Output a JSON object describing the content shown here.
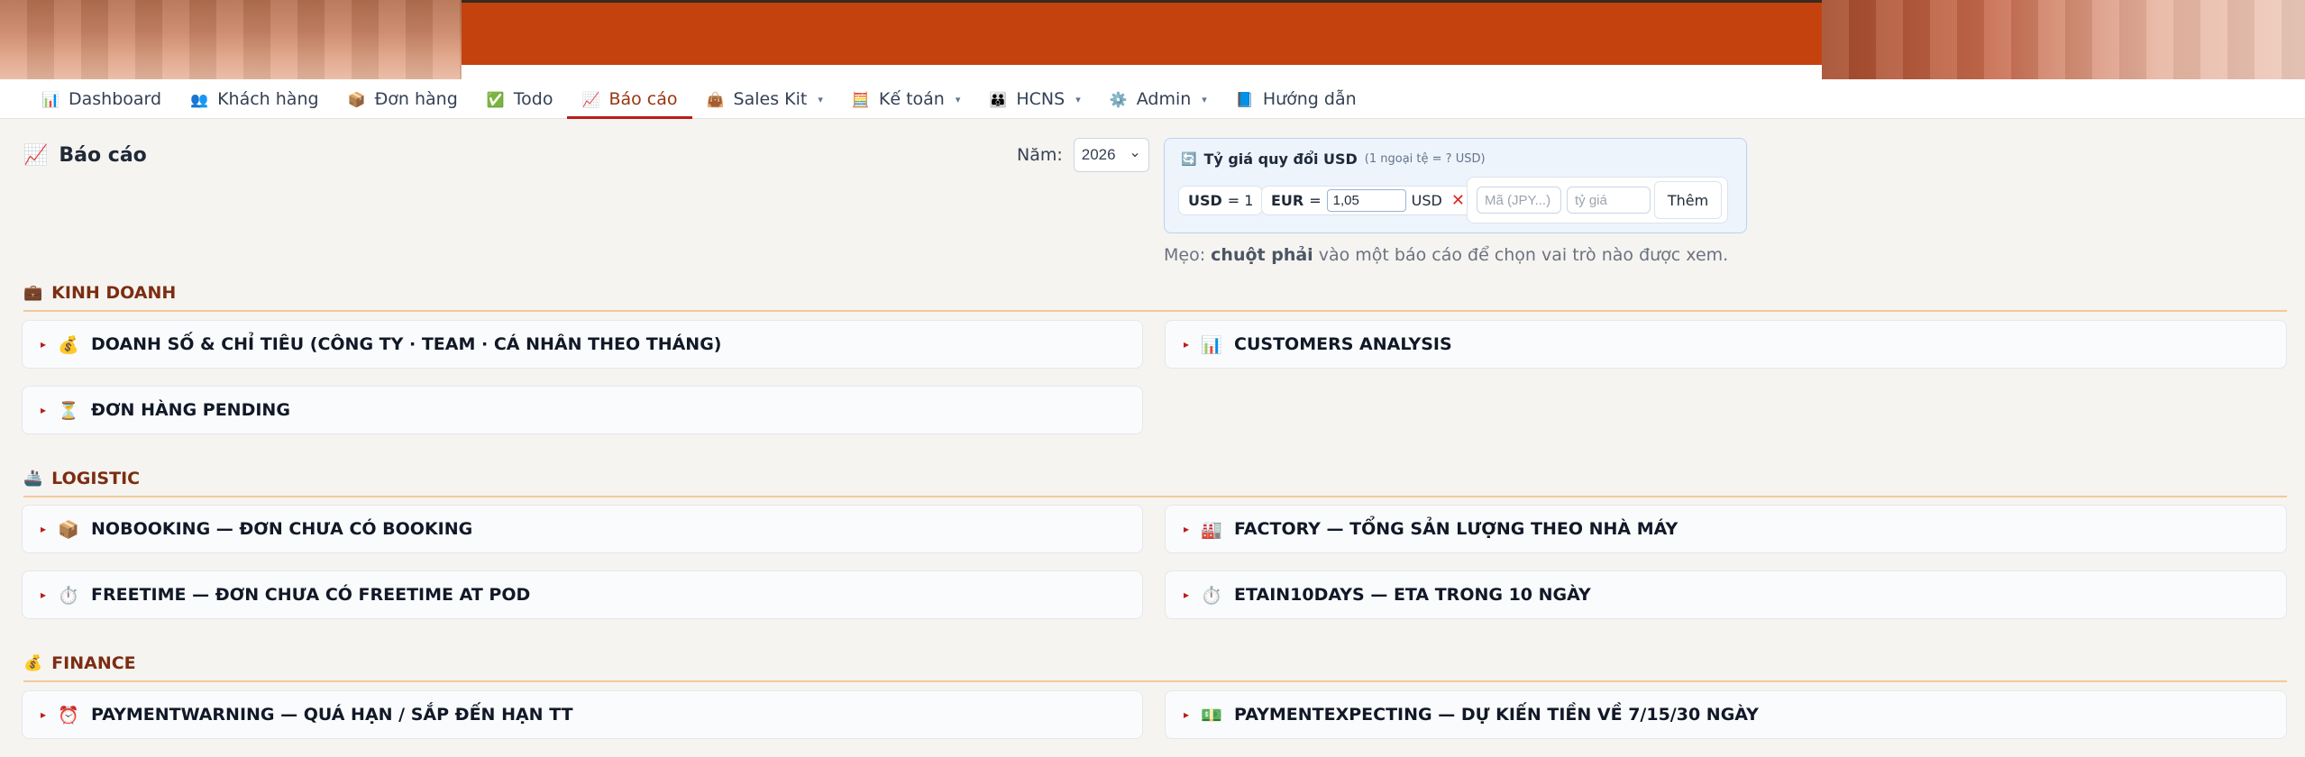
{
  "nav": {
    "items": [
      {
        "label": "Dashboard",
        "icon": "📊",
        "icon_name": "chart-bar-icon",
        "dropdown": false,
        "active": false
      },
      {
        "label": "Khách hàng",
        "icon": "👥",
        "icon_name": "users-icon",
        "dropdown": false,
        "active": false
      },
      {
        "label": "Đơn hàng",
        "icon": "📦",
        "icon_name": "package-icon",
        "dropdown": false,
        "active": false
      },
      {
        "label": "Todo",
        "icon": "✅",
        "icon_name": "checkbox-icon",
        "dropdown": false,
        "active": false
      },
      {
        "label": "Báo cáo",
        "icon": "📈",
        "icon_name": "chart-up-icon",
        "dropdown": false,
        "active": true
      },
      {
        "label": "Sales Kit",
        "icon": "👜",
        "icon_name": "bag-icon",
        "dropdown": true,
        "active": false
      },
      {
        "label": "Kế toán",
        "icon": "🧮",
        "icon_name": "abacus-icon",
        "dropdown": true,
        "active": false
      },
      {
        "label": "HCNS",
        "icon": "👪",
        "icon_name": "family-icon",
        "dropdown": true,
        "active": false
      },
      {
        "label": "Admin",
        "icon": "⚙️",
        "icon_name": "gear-icon",
        "dropdown": true,
        "active": false
      },
      {
        "label": "Hướng dẫn",
        "icon": "📘",
        "icon_name": "book-icon",
        "dropdown": false,
        "active": false
      }
    ]
  },
  "page": {
    "title": "Báo cáo",
    "title_icon": "📈",
    "year_label": "Năm:",
    "year_value": "2026"
  },
  "fx": {
    "title": "Tỷ giá quy đổi USD",
    "note": "(1 ngoại tệ = ? USD)",
    "title_icon": "🔄",
    "base_code": "USD",
    "base_eq": "= 1",
    "rate_code": "EUR",
    "rate_eq": "=",
    "rate_value": "1,05",
    "rate_unit": "USD",
    "remove_glyph": "✕",
    "code_placeholder": "Mã (JPY...)",
    "rate_placeholder": "tỷ giá",
    "add_label": "Thêm"
  },
  "tip": {
    "prefix": "Mẹo:",
    "bold": "chuột phải",
    "suffix": "vào một báo cáo để chọn vai trò nào được xem."
  },
  "sections": [
    {
      "title": "KINH DOANH",
      "icon": "💼",
      "reports": [
        {
          "label": "DOANH SỐ & CHỈ TIÊU (CÔNG TY · TEAM · CÁ NHÂN THEO THÁNG)",
          "icon": "💰"
        },
        {
          "label": "CUSTOMERS ANALYSIS",
          "icon": "📊"
        },
        {
          "label": "ĐƠN HÀNG PENDING",
          "icon": "⏳"
        }
      ]
    },
    {
      "title": "LOGISTIC",
      "icon": "🚢",
      "reports": [
        {
          "label": "NOBOOKING — ĐƠN CHƯA CÓ BOOKING",
          "icon": "📦"
        },
        {
          "label": "FACTORY — TỔNG SẢN LƯỢNG THEO NHÀ MÁY",
          "icon": "🏭"
        },
        {
          "label": "FREETIME — ĐƠN CHƯA CÓ FREETIME AT POD",
          "icon": "⏱️"
        },
        {
          "label": "ETAIN10DAYS — ETA TRONG 10 NGÀY",
          "icon": "⏱️"
        }
      ]
    },
    {
      "title": "FINANCE",
      "icon": "💰",
      "reports": [
        {
          "label": "PAYMENTWARNING — QUÁ HẠN / SẮP ĐẾN HẠN TT",
          "icon": "⏰"
        },
        {
          "label": "PAYMENTEXPECTING — DỰ KIẾN TIỀN VỀ 7/15/30 NGÀY",
          "icon": "💵"
        }
      ]
    }
  ],
  "glyphs": {
    "caret": "▾",
    "triangle": "▸",
    "select_caret": "⌄"
  }
}
